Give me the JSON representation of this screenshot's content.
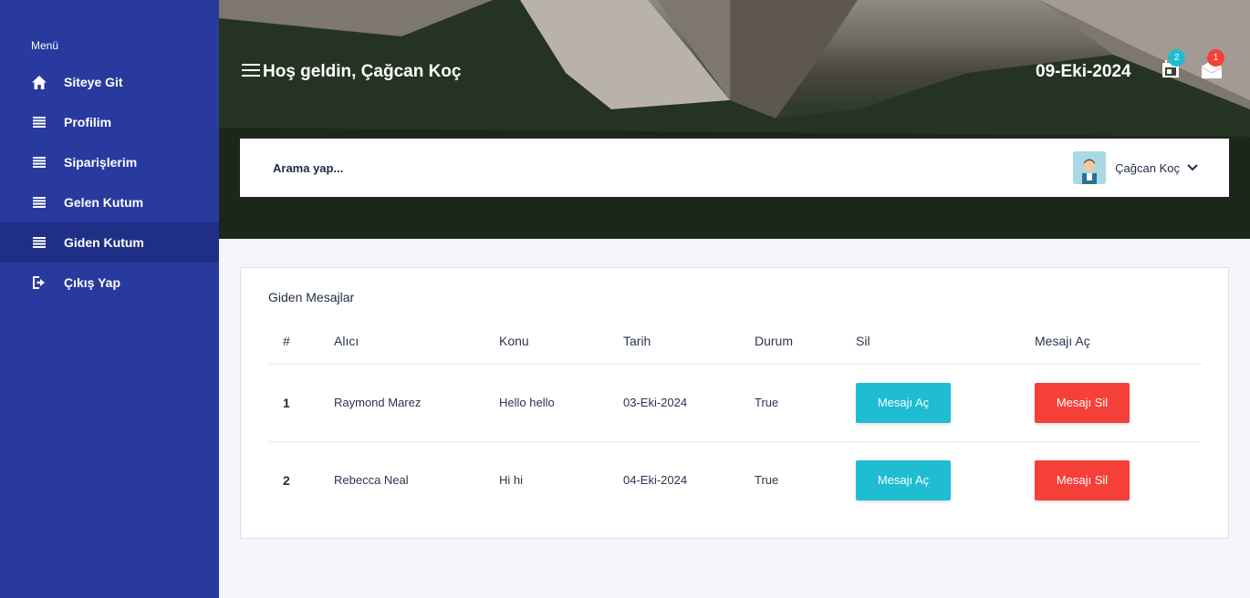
{
  "sidebar": {
    "menu_label": "Menü",
    "items": [
      {
        "label": "Siteye Git",
        "icon": "home-icon"
      },
      {
        "label": "Profilim",
        "icon": "list-icon"
      },
      {
        "label": "Siparişlerim",
        "icon": "list-icon"
      },
      {
        "label": "Gelen Kutum",
        "icon": "list-icon"
      },
      {
        "label": "Giden Kutum",
        "icon": "list-icon",
        "active": true
      },
      {
        "label": "Çıkış Yap",
        "icon": "logout-icon"
      }
    ],
    "bg_color": "#283a9e",
    "active_color": "#1f2f86"
  },
  "header": {
    "welcome": "Hoş geldin, Çağcan Koç",
    "date": "09-Eki-2024",
    "notifications_count": "2",
    "messages_count": "1",
    "notification_badge_color": "#1fbcd2",
    "message_badge_color": "#f5403a"
  },
  "search": {
    "placeholder": "Arama yap..."
  },
  "user": {
    "name": "Çağcan Koç"
  },
  "card": {
    "title": "Giden Mesajlar",
    "columns": [
      "#",
      "Alıcı",
      "Konu",
      "Tarih",
      "Durum",
      "Sil",
      "Mesajı Aç"
    ],
    "rows": [
      {
        "num": "1",
        "recipient": "Raymond Marez",
        "subject": "Hello hello",
        "date": "03-Eki-2024",
        "status": "True",
        "open_label": "Mesajı Aç",
        "delete_label": "Mesajı Sil"
      },
      {
        "num": "2",
        "recipient": "Rebecca Neal",
        "subject": "Hi hi",
        "date": "04-Eki-2024",
        "status": "True",
        "open_label": "Mesajı Aç",
        "delete_label": "Mesajı Sil"
      }
    ]
  }
}
